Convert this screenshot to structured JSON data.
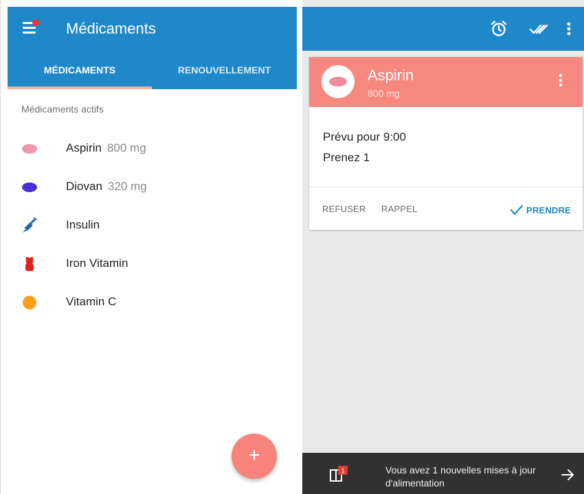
{
  "left": {
    "title": "Médicaments",
    "tabs": [
      {
        "label": "MÉDICAMENTS",
        "active": true
      },
      {
        "label": "RENOUVELLEMENT",
        "active": false
      }
    ],
    "section_label": "Médicaments actifs",
    "medications": [
      {
        "name": "Aspirin",
        "dose": "800 mg",
        "icon": "pink-pill-icon",
        "color": "#f199ac"
      },
      {
        "name": "Diovan",
        "dose": "320 mg",
        "icon": "purple-pill-icon",
        "color": "#4a2fd8"
      },
      {
        "name": "Insulin",
        "dose": "",
        "icon": "syringe-icon",
        "color": "#1f66b0"
      },
      {
        "name": "Iron Vitamin",
        "dose": "",
        "icon": "gummy-bear-icon",
        "color": "#e0201e"
      },
      {
        "name": "Vitamin C",
        "dose": "",
        "icon": "orange-pill-icon",
        "color": "#f9a11b"
      }
    ],
    "fab_label": "+",
    "notification_dot": true
  },
  "right": {
    "card": {
      "title": "Aspirin",
      "dose": "800 mg",
      "scheduled": "Prévu pour 9:00",
      "instruction": "Prenez 1",
      "actions": {
        "refuse": "REFUSER",
        "remind": "RAPPEL",
        "take": "PRENDRE"
      }
    },
    "snackbar": {
      "badge_count": "1",
      "message": "Vous avez 1 nouvelles mises à jour d'alimentation"
    }
  },
  "colors": {
    "primary": "#1e88c9",
    "accent": "#f7837a",
    "card_header": "#f7887f",
    "snackbar": "#313131"
  }
}
